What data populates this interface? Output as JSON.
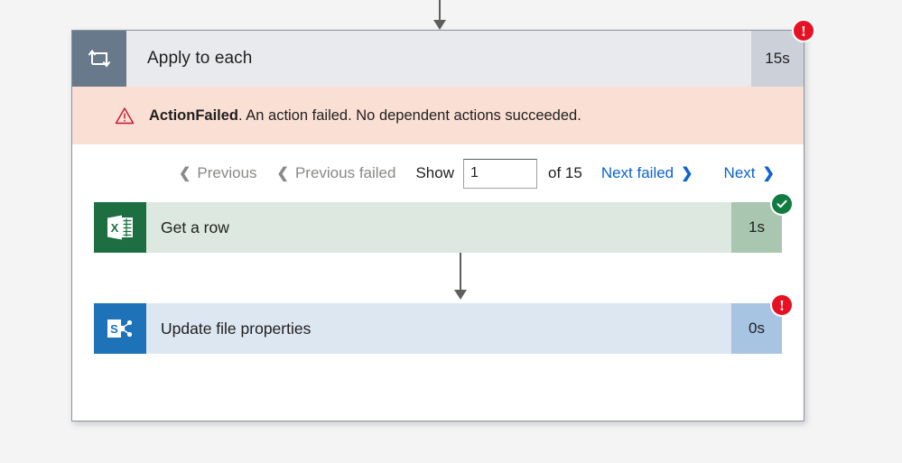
{
  "scope": {
    "icon": "loop-repeat-icon",
    "title": "Apply to each",
    "duration": "15s",
    "status": "failed",
    "status_badge_glyph": "!"
  },
  "error_banner": {
    "icon": "warning-triangle-icon",
    "code": "ActionFailed",
    "message": ". An action failed. No dependent actions succeeded."
  },
  "pager": {
    "previous_label": "Previous",
    "previous_failed_label": "Previous failed",
    "show_label": "Show",
    "current_page": "1",
    "of_label": "of 15",
    "next_failed_label": "Next failed",
    "next_label": "Next",
    "chevron_left": "❮",
    "chevron_right": "❯"
  },
  "actions": [
    {
      "icon": "excel-icon",
      "title": "Get a row",
      "duration": "1s",
      "status": "succeeded",
      "status_badge_glyph": "✓"
    },
    {
      "icon": "sharepoint-icon",
      "title": "Update file properties",
      "duration": "0s",
      "status": "failed",
      "status_badge_glyph": "!"
    }
  ],
  "colors": {
    "page_background": "#f4f4f4",
    "card_border": "#8a94a0",
    "scope_icon_bg": "#69798c",
    "scope_header_bg": "#e9eaee",
    "scope_duration_bg": "#ccd1d9",
    "error_banner_bg": "#fadfd5",
    "error_red": "#e81123",
    "success_green": "#107c41",
    "link_blue": "#0b63ce",
    "disabled_gray": "#8a8886",
    "excel_green": "#1d6f42",
    "excel_row_bg": "#dde8e0",
    "excel_duration_bg": "#a9c6b0",
    "sharepoint_blue": "#1d72b8",
    "sharepoint_row_bg": "#dde7f2",
    "sharepoint_duration_bg": "#a7c4e2",
    "connector_gray": "#605e5c"
  }
}
